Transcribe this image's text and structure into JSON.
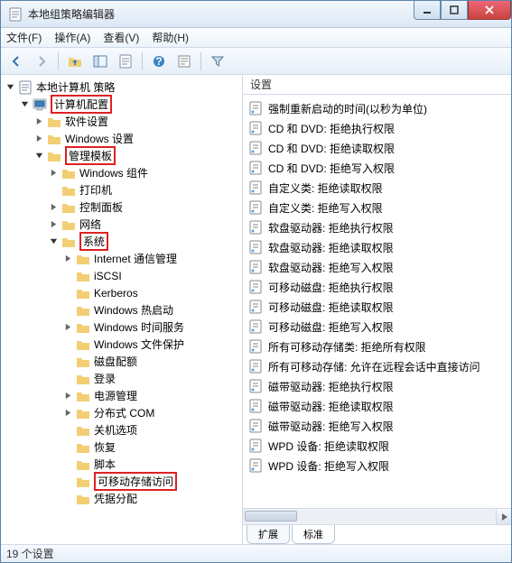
{
  "window": {
    "title": "本地组策略编辑器"
  },
  "menu": {
    "file": "文件(F)",
    "action": "操作(A)",
    "view": "查看(V)",
    "help": "帮助(H)"
  },
  "toolbar_icons": [
    "back",
    "forward",
    "up",
    "show-hide-tree",
    "export",
    "help",
    "properties",
    "filter"
  ],
  "tree": {
    "root": "本地计算机 策略",
    "computer_config": "计算机配置",
    "software_settings": "软件设置",
    "windows_settings": "Windows 设置",
    "admin_templates": "管理模板",
    "windows_components": "Windows 组件",
    "printers": "打印机",
    "control_panel": "控制面板",
    "network": "网络",
    "system": "系统",
    "internet_comm": "Internet 通信管理",
    "iscsi": "iSCSI",
    "kerberos": "Kerberos",
    "win_hot_boot": "Windows 热启动",
    "win_time": "Windows 时间服务",
    "win_file_protect": "Windows 文件保护",
    "disk_quota": "磁盘配额",
    "logon": "登录",
    "power_mgmt": "电源管理",
    "dcom": "分布式 COM",
    "shutdown_opts": "关机选项",
    "recovery": "恢复",
    "scripts": "脚本",
    "removable_storage": "可移动存储访问",
    "credential_delegation": "凭据分配"
  },
  "right": {
    "header": "设置",
    "items": [
      "强制重新启动的时间(以秒为单位)",
      "CD 和 DVD: 拒绝执行权限",
      "CD 和 DVD: 拒绝读取权限",
      "CD 和 DVD: 拒绝写入权限",
      "自定义类: 拒绝读取权限",
      "自定义类: 拒绝写入权限",
      "软盘驱动器: 拒绝执行权限",
      "软盘驱动器: 拒绝读取权限",
      "软盘驱动器: 拒绝写入权限",
      "可移动磁盘: 拒绝执行权限",
      "可移动磁盘: 拒绝读取权限",
      "可移动磁盘: 拒绝写入权限",
      "所有可移动存储类: 拒绝所有权限",
      "所有可移动存储: 允许在远程会话中直接访问",
      "磁带驱动器: 拒绝执行权限",
      "磁带驱动器: 拒绝读取权限",
      "磁带驱动器: 拒绝写入权限",
      "WPD 设备: 拒绝读取权限",
      "WPD 设备: 拒绝写入权限"
    ]
  },
  "tabs": {
    "extended": "扩展",
    "standard": "标准"
  },
  "status": "19 个设置"
}
